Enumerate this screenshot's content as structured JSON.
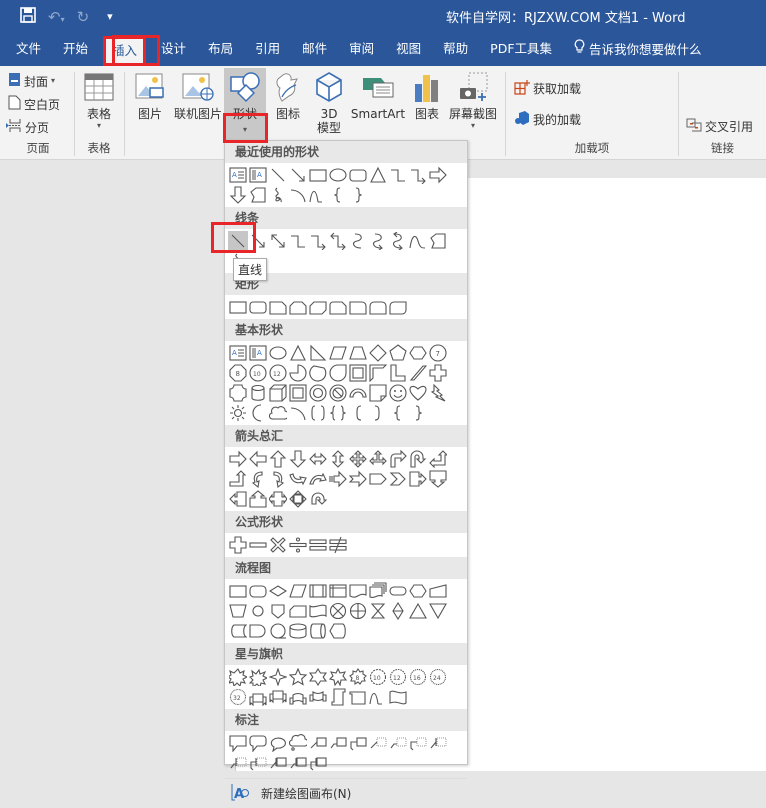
{
  "titlebar": {
    "title": "软件自学网：RJZXW.COM 文档1  -  Word",
    "qat": [
      {
        "icon": "save-icon",
        "glyph": "💾"
      },
      {
        "icon": "undo-icon",
        "glyph": "↶"
      },
      {
        "icon": "redo-icon",
        "glyph": "↻"
      },
      {
        "icon": "customize-qat-icon",
        "glyph": "⩡"
      }
    ]
  },
  "tabs": [
    {
      "label": "文件",
      "active": false
    },
    {
      "label": "开始",
      "active": false
    },
    {
      "label": "插入",
      "active": true
    },
    {
      "label": "设计",
      "active": false
    },
    {
      "label": "布局",
      "active": false
    },
    {
      "label": "引用",
      "active": false
    },
    {
      "label": "邮件",
      "active": false
    },
    {
      "label": "审阅",
      "active": false
    },
    {
      "label": "视图",
      "active": false
    },
    {
      "label": "帮助",
      "active": false
    },
    {
      "label": "PDF工具集",
      "active": false
    }
  ],
  "tell_me": "告诉我你想要做什么",
  "ribbon": {
    "pages": {
      "label": "页面",
      "cover": "封面",
      "blank": "空白页",
      "break": "分页"
    },
    "tables": {
      "label": "表格",
      "table": "表格"
    },
    "illustrations": {
      "picture": "图片",
      "online_picture": "联机图片",
      "shapes": "形状",
      "icons": "图标",
      "model3d_line1": "3D",
      "model3d_line2": "模型",
      "smartart": "SmartArt",
      "chart": "图表",
      "screenshot": "屏幕截图"
    },
    "addins": {
      "label": "加载项",
      "get": "获取加载",
      "mine": "我的加载"
    },
    "links": {
      "label": "链接",
      "crossref": "交叉引用"
    }
  },
  "shapes_panel": {
    "sections": [
      {
        "title": "最近使用的形状",
        "shapes": [
          "textbox",
          "vtextbox",
          "line",
          "arrow-line",
          "rectangle",
          "oval",
          "rounded-rect",
          "triangle",
          "elbow",
          "elbow-arrow",
          "right-arrow",
          "down-arrow",
          "freeform",
          "scribble",
          "arc",
          "wave",
          "left-brace",
          "right-brace"
        ]
      },
      {
        "title": "线条",
        "shapes": [
          "line",
          "arrow-line",
          "double-arrow-line",
          "elbow",
          "elbow-arrow",
          "elbow-double-arrow",
          "curve",
          "curve-arrow",
          "curve-double-arrow",
          "curve-line",
          "freeform",
          "scribble"
        ],
        "selected_index": 0
      },
      {
        "title": "矩形",
        "shapes": [
          "rectangle",
          "rounded-rect",
          "snip1-rect",
          "snip2-rect",
          "snip-diag-rect",
          "snip-round-rect",
          "round1-rect",
          "round2-rect",
          "round-diag-rect"
        ]
      },
      {
        "title": "基本形状",
        "shapes": [
          "textbox",
          "vtextbox",
          "oval",
          "triangle",
          "right-triangle",
          "parallelogram",
          "trapezoid",
          "diamond",
          "pentagon",
          "hexagon",
          "heptagon",
          "octagon",
          "decagon",
          "dodecagon",
          "pie",
          "chord",
          "teardrop",
          "frame",
          "half-frame",
          "l-shape",
          "diag-stripe",
          "cross",
          "plaque",
          "can",
          "cube",
          "bevel",
          "donut",
          "no-symbol",
          "block-arc",
          "folded-corner",
          "smiley",
          "heart",
          "lightning",
          "sun",
          "moon",
          "cloud",
          "arc",
          "double-bracket",
          "double-brace",
          "left-bracket",
          "right-bracket",
          "left-brace",
          "right-brace"
        ]
      },
      {
        "title": "箭头总汇",
        "shapes": [
          "right-arrow",
          "left-arrow",
          "up-arrow",
          "down-arrow",
          "left-right-arrow",
          "up-down-arrow",
          "quad-arrow",
          "left-right-up-arrow",
          "bent-arrow",
          "u-turn-arrow",
          "left-up-arrow",
          "bent-up-arrow",
          "curved-right-arrow",
          "curved-left-arrow",
          "curved-up-arrow",
          "curved-down-arrow",
          "striped-right-arrow",
          "notched-right-arrow",
          "pentagon-arrow",
          "chevron",
          "right-arrow-callout",
          "down-arrow-callout",
          "left-arrow-callout",
          "up-arrow-callout",
          "left-right-arrow-callout",
          "quad-arrow-callout",
          "circular-arrow"
        ]
      },
      {
        "title": "公式形状",
        "shapes": [
          "plus",
          "minus",
          "multiply",
          "divide",
          "equal",
          "not-equal"
        ]
      },
      {
        "title": "流程图",
        "shapes": [
          "process",
          "alt-process",
          "decision",
          "data",
          "predefined",
          "internal-storage",
          "document",
          "multidocument",
          "terminator",
          "preparation",
          "manual-input",
          "manual-operation",
          "connector",
          "offpage-connector",
          "card",
          "punched-tape",
          "summing-junction",
          "or",
          "collate",
          "sort",
          "extract",
          "merge",
          "stored-data",
          "delay",
          "seq-access",
          "magnetic-disk",
          "direct-access",
          "display"
        ]
      },
      {
        "title": "星与旗帜",
        "shapes": [
          "explosion1",
          "explosion2",
          "star4",
          "star5",
          "star6",
          "star7",
          "star8",
          "star10",
          "star12",
          "star16",
          "star24",
          "star32",
          "ribbon-up",
          "ribbon-down",
          "curved-ribbon-up",
          "curved-ribbon-down",
          "vertical-scroll",
          "horizontal-scroll",
          "wave",
          "double-wave"
        ]
      },
      {
        "title": "标注",
        "shapes": [
          "rect-callout",
          "rounded-callout",
          "oval-callout",
          "cloud-callout",
          "line-callout1",
          "line-callout2",
          "line-callout3",
          "line-callout1-noborder",
          "line-callout2-noborder",
          "line-callout3-noborder",
          "line-callout1-accent",
          "line-callout2-accent",
          "line-callout3-accent",
          "line-callout1-border",
          "line-callout2-border",
          "line-callout3-border"
        ]
      }
    ],
    "tooltip": "直线",
    "new_canvas": "新建绘图画布(N)"
  },
  "colors": {
    "accent": "#2b579a",
    "highlight_box": "#e8262a"
  }
}
